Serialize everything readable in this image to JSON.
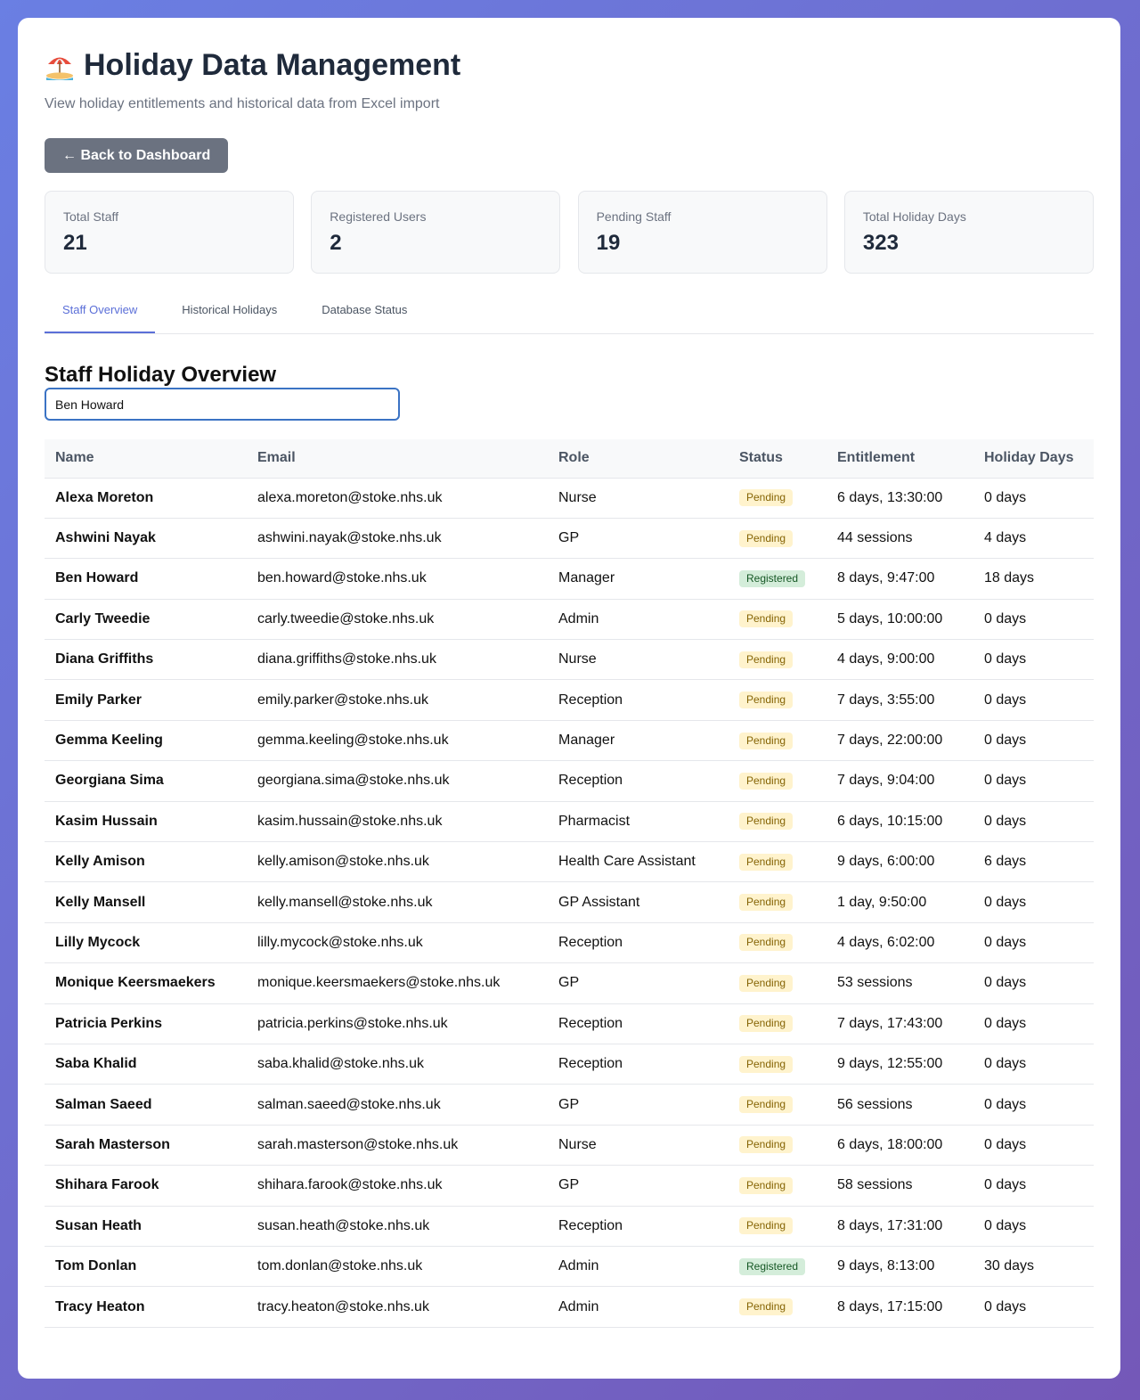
{
  "header": {
    "title": "Holiday Data Management",
    "subtitle": "View holiday entitlements and historical data from Excel import",
    "back_label": "← Back to Dashboard"
  },
  "stats": [
    {
      "label": "Total Staff",
      "value": "21"
    },
    {
      "label": "Registered Users",
      "value": "2"
    },
    {
      "label": "Pending Staff",
      "value": "19"
    },
    {
      "label": "Total Holiday Days",
      "value": "323"
    }
  ],
  "tabs": [
    {
      "label": "Staff Overview",
      "active": true
    },
    {
      "label": "Historical Holidays",
      "active": false
    },
    {
      "label": "Database Status",
      "active": false
    }
  ],
  "overview": {
    "title": "Staff Holiday Overview",
    "search_value": "Ben Howard"
  },
  "table": {
    "headers": [
      "Name",
      "Email",
      "Role",
      "Status",
      "Entitlement",
      "Holiday Days"
    ],
    "rows": [
      {
        "name": "Alexa Moreton",
        "email": "alexa.moreton@stoke.nhs.uk",
        "role": "Nurse",
        "status": "Pending",
        "entitlement": "6 days, 13:30:00",
        "holiday_days": "0 days"
      },
      {
        "name": "Ashwini Nayak",
        "email": "ashwini.nayak@stoke.nhs.uk",
        "role": "GP",
        "status": "Pending",
        "entitlement": "44 sessions",
        "holiday_days": "4 days"
      },
      {
        "name": "Ben Howard",
        "email": "ben.howard@stoke.nhs.uk",
        "role": "Manager",
        "status": "Registered",
        "entitlement": "8 days, 9:47:00",
        "holiday_days": "18 days"
      },
      {
        "name": "Carly Tweedie",
        "email": "carly.tweedie@stoke.nhs.uk",
        "role": "Admin",
        "status": "Pending",
        "entitlement": "5 days, 10:00:00",
        "holiday_days": "0 days"
      },
      {
        "name": "Diana Griffiths",
        "email": "diana.griffiths@stoke.nhs.uk",
        "role": "Nurse",
        "status": "Pending",
        "entitlement": "4 days, 9:00:00",
        "holiday_days": "0 days"
      },
      {
        "name": "Emily Parker",
        "email": "emily.parker@stoke.nhs.uk",
        "role": "Reception",
        "status": "Pending",
        "entitlement": "7 days, 3:55:00",
        "holiday_days": "0 days"
      },
      {
        "name": "Gemma Keeling",
        "email": "gemma.keeling@stoke.nhs.uk",
        "role": "Manager",
        "status": "Pending",
        "entitlement": "7 days, 22:00:00",
        "holiday_days": "0 days"
      },
      {
        "name": "Georgiana Sima",
        "email": "georgiana.sima@stoke.nhs.uk",
        "role": "Reception",
        "status": "Pending",
        "entitlement": "7 days, 9:04:00",
        "holiday_days": "0 days"
      },
      {
        "name": "Kasim Hussain",
        "email": "kasim.hussain@stoke.nhs.uk",
        "role": "Pharmacist",
        "status": "Pending",
        "entitlement": "6 days, 10:15:00",
        "holiday_days": "0 days"
      },
      {
        "name": "Kelly Amison",
        "email": "kelly.amison@stoke.nhs.uk",
        "role": "Health Care Assistant",
        "status": "Pending",
        "entitlement": "9 days, 6:00:00",
        "holiday_days": "6 days"
      },
      {
        "name": "Kelly Mansell",
        "email": "kelly.mansell@stoke.nhs.uk",
        "role": "GP Assistant",
        "status": "Pending",
        "entitlement": "1 day, 9:50:00",
        "holiday_days": "0 days"
      },
      {
        "name": "Lilly Mycock",
        "email": "lilly.mycock@stoke.nhs.uk",
        "role": "Reception",
        "status": "Pending",
        "entitlement": "4 days, 6:02:00",
        "holiday_days": "0 days"
      },
      {
        "name": "Monique Keersmaekers",
        "email": "monique.keersmaekers@stoke.nhs.uk",
        "role": "GP",
        "status": "Pending",
        "entitlement": "53 sessions",
        "holiday_days": "0 days"
      },
      {
        "name": "Patricia Perkins",
        "email": "patricia.perkins@stoke.nhs.uk",
        "role": "Reception",
        "status": "Pending",
        "entitlement": "7 days, 17:43:00",
        "holiday_days": "0 days"
      },
      {
        "name": "Saba Khalid",
        "email": "saba.khalid@stoke.nhs.uk",
        "role": "Reception",
        "status": "Pending",
        "entitlement": "9 days, 12:55:00",
        "holiday_days": "0 days"
      },
      {
        "name": "Salman Saeed",
        "email": "salman.saeed@stoke.nhs.uk",
        "role": "GP",
        "status": "Pending",
        "entitlement": "56 sessions",
        "holiday_days": "0 days"
      },
      {
        "name": "Sarah Masterson",
        "email": "sarah.masterson@stoke.nhs.uk",
        "role": "Nurse",
        "status": "Pending",
        "entitlement": "6 days, 18:00:00",
        "holiday_days": "0 days"
      },
      {
        "name": "Shihara Farook",
        "email": "shihara.farook@stoke.nhs.uk",
        "role": "GP",
        "status": "Pending",
        "entitlement": "58 sessions",
        "holiday_days": "0 days"
      },
      {
        "name": "Susan Heath",
        "email": "susan.heath@stoke.nhs.uk",
        "role": "Reception",
        "status": "Pending",
        "entitlement": "8 days, 17:31:00",
        "holiday_days": "0 days"
      },
      {
        "name": "Tom Donlan",
        "email": "tom.donlan@stoke.nhs.uk",
        "role": "Admin",
        "status": "Registered",
        "entitlement": "9 days, 8:13:00",
        "holiday_days": "30 days"
      },
      {
        "name": "Tracy Heaton",
        "email": "tracy.heaton@stoke.nhs.uk",
        "role": "Admin",
        "status": "Pending",
        "entitlement": "8 days, 17:15:00",
        "holiday_days": "0 days"
      }
    ]
  },
  "colors": {
    "accent": "#5b6fd8",
    "pending_bg": "#fff3cd",
    "pending_text": "#856404",
    "registered_bg": "#d4edda",
    "registered_text": "#155724",
    "button_bg": "#6b7280"
  },
  "icons": {
    "title_icon": "beach-umbrella-icon"
  }
}
